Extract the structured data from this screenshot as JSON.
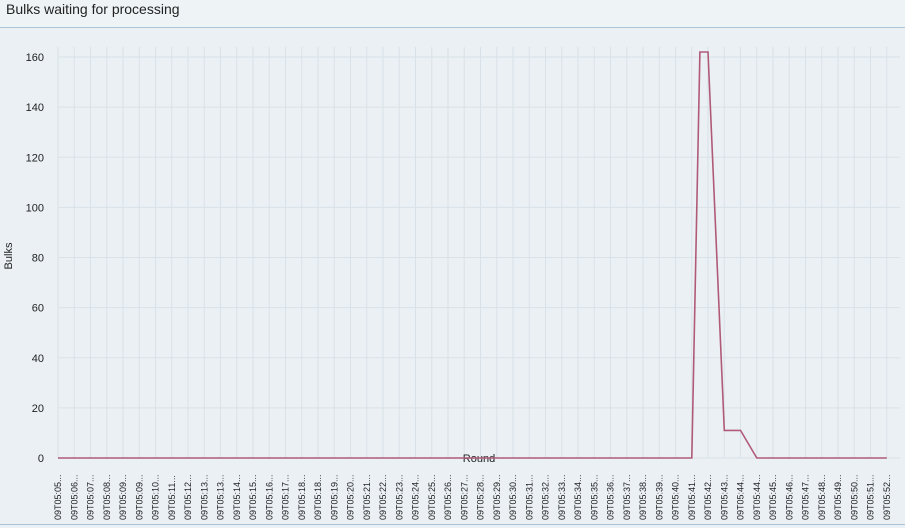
{
  "panel": {
    "title": "Bulks waiting for processing"
  },
  "chart_data": {
    "type": "line",
    "xlabel": "Round",
    "ylabel": "Bulks",
    "ylim": [
      0,
      160
    ],
    "yticks": [
      0,
      20,
      40,
      60,
      80,
      100,
      120,
      140,
      160
    ],
    "grid": true,
    "line_color": "#b05a78",
    "categories": [
      "09T05:05...",
      "09T05:06...",
      "09T05:07...",
      "09T05:08...",
      "09T05:09...",
      "09T05:09...",
      "09T05:10...",
      "09T05:11...",
      "09T05:12...",
      "09T05:13...",
      "09T05:13...",
      "09T05:14...",
      "09T05:15...",
      "09T05:16...",
      "09T05:17...",
      "09T05:18...",
      "09T05:18...",
      "09T05:19...",
      "09T05:20...",
      "09T05:21...",
      "09T05:22...",
      "09T05:23...",
      "09T05:24...",
      "09T05:25...",
      "09T05:26...",
      "09T05:27...",
      "09T05:28...",
      "09T05:29...",
      "09T05:30...",
      "09T05:31...",
      "09T05:32...",
      "09T05:33...",
      "09T05:34...",
      "09T05:35...",
      "09T05:36...",
      "09T05:37...",
      "09T05:38...",
      "09T05:39...",
      "09T05:40...",
      "09T05:41...",
      "09T05:42...",
      "09T05:43...",
      "09T05:44...",
      "09T05:44...",
      "09T05:45...",
      "09T05:46...",
      "09T05:47...",
      "09T05:48...",
      "09T05:49...",
      "09T05:50...",
      "09T05:51...",
      "09T05:52..."
    ],
    "series": [
      {
        "values": [
          0,
          0,
          0,
          0,
          0,
          0,
          0,
          0,
          0,
          0,
          0,
          0,
          0,
          0,
          0,
          0,
          0,
          0,
          0,
          0,
          0,
          0,
          0,
          0,
          0,
          0,
          0,
          0,
          0,
          0,
          0,
          0,
          0,
          0,
          0,
          0,
          0,
          0,
          0,
          0,
          162,
          162,
          11,
          0,
          0,
          0,
          0,
          0,
          0,
          0,
          0,
          0
        ],
        "detail": [
          {
            "index": 39,
            "y": 0
          },
          {
            "index": 39.5,
            "y": 162
          },
          {
            "index": 40,
            "y": 162
          },
          {
            "index": 41,
            "y": 11
          }
        ]
      }
    ]
  }
}
